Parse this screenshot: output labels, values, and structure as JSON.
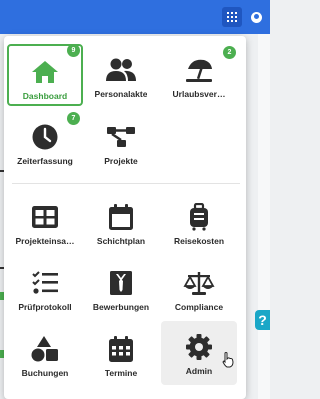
{
  "colors": {
    "topbar": "#2f6fdf",
    "accent_green": "#4caf50",
    "icon_dark": "#2d2d2d",
    "help": "#1aa7c7"
  },
  "topbar": {
    "apps_icon": "apps-grid-icon",
    "user_icon": "user-circle-icon"
  },
  "help": {
    "label": "?"
  },
  "menu": {
    "apps": [
      {
        "label": "Dashboard",
        "icon": "home-icon",
        "badge": "9",
        "active": true
      },
      {
        "label": "Personalakte",
        "icon": "users-icon"
      },
      {
        "label": "Urlaubsver…",
        "icon": "beach-umbrella-icon",
        "badge": "2"
      },
      {
        "label": "Zeiterfassung",
        "icon": "clock-icon",
        "badge": "7"
      },
      {
        "label": "Projekte",
        "icon": "project-diagram-icon"
      }
    ],
    "tools": [
      {
        "label": "Projekteinsa…",
        "icon": "table-grid-icon"
      },
      {
        "label": "Schichtplan",
        "icon": "calendar-icon"
      },
      {
        "label": "Reisekosten",
        "icon": "suitcase-icon"
      },
      {
        "label": "Prüfprotokoll",
        "icon": "checklist-icon"
      },
      {
        "label": "Bewerbungen",
        "icon": "id-badge-icon"
      },
      {
        "label": "Compliance",
        "icon": "scale-icon"
      },
      {
        "label": "Buchungen",
        "icon": "shapes-icon"
      },
      {
        "label": "Termine",
        "icon": "calendar-grid-icon"
      },
      {
        "label": "Admin",
        "icon": "gear-icon",
        "hover": true
      }
    ]
  }
}
